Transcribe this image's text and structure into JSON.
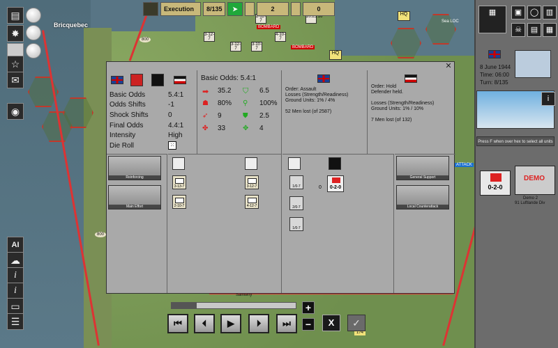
{
  "map": {
    "place_name": "Bricquebec",
    "labels": [
      "Sainteny",
      "Sea LOC",
      "HQ",
      "HQ",
      "BOMBARD",
      "BOMBARD",
      "800",
      "800",
      "174",
      "ATTACK"
    ]
  },
  "top_bar": {
    "phase": "Execution",
    "turn_counter": "8/135",
    "allied_value": "2",
    "axis_value": "0"
  },
  "top_units": [
    "2-12-7",
    "3-12-7",
    "3-12-7",
    "3-10-7",
    "4-10-7",
    "20.25.16"
  ],
  "right_panel": {
    "date": "8 June 1944",
    "time": "Time: 06:00",
    "turn": "Turn: 8/135",
    "notice": "Press F when over hex to select all units",
    "demo_unit": "0-2-0",
    "demo_photo_label": "DEMO",
    "demo_unit_id": "Demo 2",
    "demo_unit_div": "91 Luftlande Div"
  },
  "combat": {
    "labels": {
      "basic_odds": "Basic Odds",
      "odds_shifts": "Odds Shifts",
      "shock_shifts": "Shock Shifts",
      "final_odds": "Final Odds",
      "intensity": "Intensity",
      "die_roll": "Die Roll"
    },
    "values": {
      "basic_odds": "5.4:1",
      "odds_shifts": "-1",
      "shock_shifts": "0",
      "final_odds": "4.4:1",
      "intensity": "High"
    },
    "odds_header": "Basic Odds: 5.4:1",
    "stats_left": [
      "35.2",
      "80%",
      "9",
      "33"
    ],
    "stats_right": [
      "6.5",
      "100%",
      "2.5",
      "4"
    ],
    "allied": {
      "order": "Order: Assault",
      "losses": "Losses (Strength/Readiness)",
      "ground": "Ground Units: 1% / 4%",
      "men": "52 Men lost (of 2587)"
    },
    "axis": {
      "order": "Order: Hold",
      "result": "Defender held.",
      "losses": "Losses (Strength/Readiness)",
      "ground": "Ground Units: 1% / 10%",
      "men": "7 Men lost (of 132)"
    },
    "photos": {
      "attacker_1": "Reinforcing",
      "attacker_2": "Main Effort",
      "defender_1": "General Support",
      "defender_2": "Local Counterattack"
    },
    "attacker_units": [
      "3-13-7",
      "2-10-7"
    ],
    "attacker_units_right": [
      "3-12-7",
      "4-12-7"
    ],
    "defender_units": [
      "1/0-7",
      "0-2-0",
      "2/0-7",
      "1/0-7"
    ],
    "defender_count": "0"
  },
  "playback": {
    "progress_fraction": 0.2,
    "step_back_all": "⏮",
    "step_back": "⏴",
    "play": "▶",
    "step_fwd": "⏵",
    "step_fwd_all": "⏭",
    "zoom_in": "+",
    "zoom_out": "−",
    "cancel": "X",
    "confirm": "✓"
  },
  "colors": {
    "allied_green": "#1fa83a",
    "axis_red": "#cc2222",
    "panel_gray": "#a9a9a9"
  }
}
